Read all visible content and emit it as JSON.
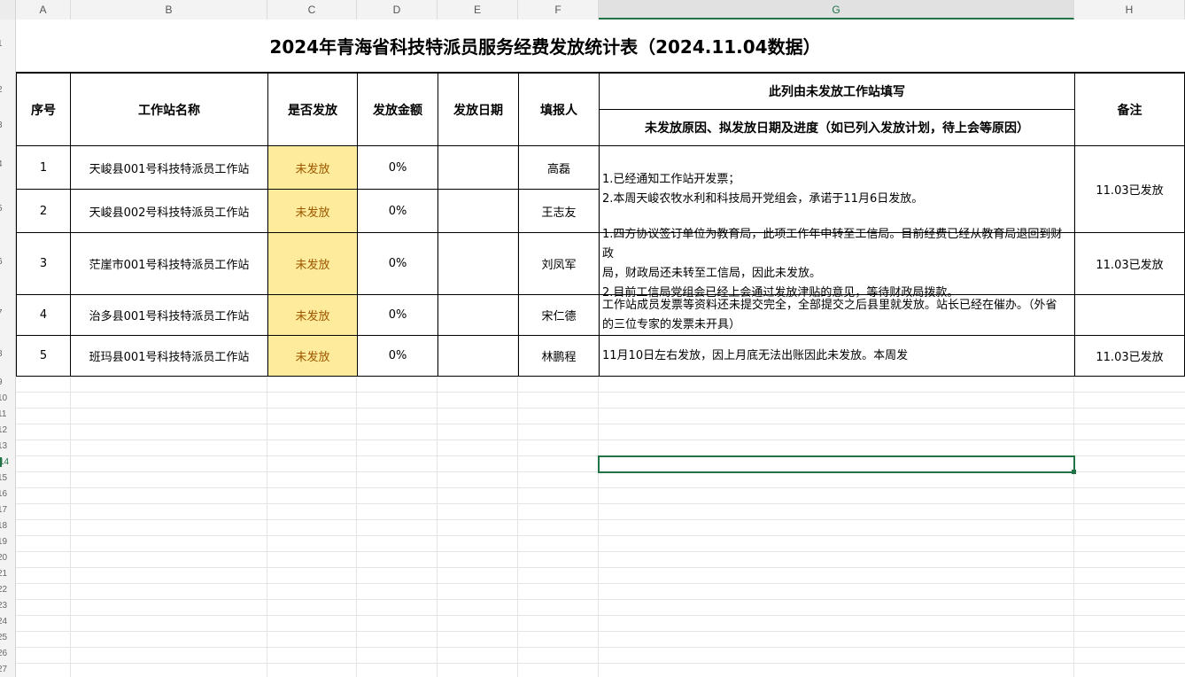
{
  "columns": [
    "A",
    "B",
    "C",
    "D",
    "E",
    "F",
    "G",
    "H"
  ],
  "rows": [
    "1",
    "2",
    "3",
    "4",
    "5",
    "6",
    "7",
    "8",
    "9",
    "10",
    "11",
    "12",
    "13",
    "14",
    "15",
    "16",
    "17",
    "18",
    "19",
    "20",
    "21",
    "22",
    "23",
    "24",
    "25",
    "26",
    "27"
  ],
  "table": {
    "title": "2024年青海省科技特派员服务经费发放统计表（2024.11.04数据）",
    "headers": {
      "seq": "序号",
      "station": "工作站名称",
      "issued": "是否发放",
      "amount": "发放金额",
      "date": "发放日期",
      "reporter": "填报人",
      "g_top": "此列由未发放工作站填写",
      "g_sub": "未发放原因、拟发放日期及进度（如已列入发放计划，待上会等原因）",
      "note": "备注"
    },
    "rows": [
      {
        "seq": "1",
        "station": "天峻县001号科技特派员工作站",
        "issued": "未发放",
        "amount": "0%",
        "date": "",
        "reporter": "高磊"
      },
      {
        "seq": "2",
        "station": "天峻县002号科技特派员工作站",
        "issued": "未发放",
        "amount": "0%",
        "date": "",
        "reporter": "王志友"
      },
      {
        "seq": "3",
        "station": "茫崖市001号科技特派员工作站",
        "issued": "未发放",
        "amount": "0%",
        "date": "",
        "reporter": "刘凤军"
      },
      {
        "seq": "4",
        "station": "治多县001号科技特派员工作站",
        "issued": "未发放",
        "amount": "0%",
        "date": "",
        "reporter": "宋仁德"
      },
      {
        "seq": "5",
        "station": "班玛县001号科技特派员工作站",
        "issued": "未发放",
        "amount": "0%",
        "date": "",
        "reporter": "林鹏程"
      }
    ],
    "reasons": {
      "r12_line1": "1.已经通知工作站开发票；",
      "r12_line2": "2.本周天峻农牧水利和科技局开党组会，承诺于11月6日发放。",
      "r3_line1": "1.四方协议签订单位为教育局，此项工作年中转至工信局。目前经费已经从教育局退回到财政",
      "r3_line2": "局，财政局还未转至工信局，因此未发放。",
      "r3_line3": "2.目前工信局党组会已经上会通过发放津贴的意见，等待财政局拨款。",
      "r4_line1": "工作站成员发票等资料还未提交完全，全部提交之后县里就发放。站长已经在催办。（外省",
      "r4_line2": "的三位专家的发票未开具）",
      "r5": "11月10日左右发放，因上月底无法出账因此未发放。本周发"
    },
    "notes": {
      "r12": "11.03已发放",
      "r3": "11.03已发放",
      "r4": "",
      "r5": "11.03已发放"
    }
  },
  "selected_column": "G",
  "selected_row": "14"
}
